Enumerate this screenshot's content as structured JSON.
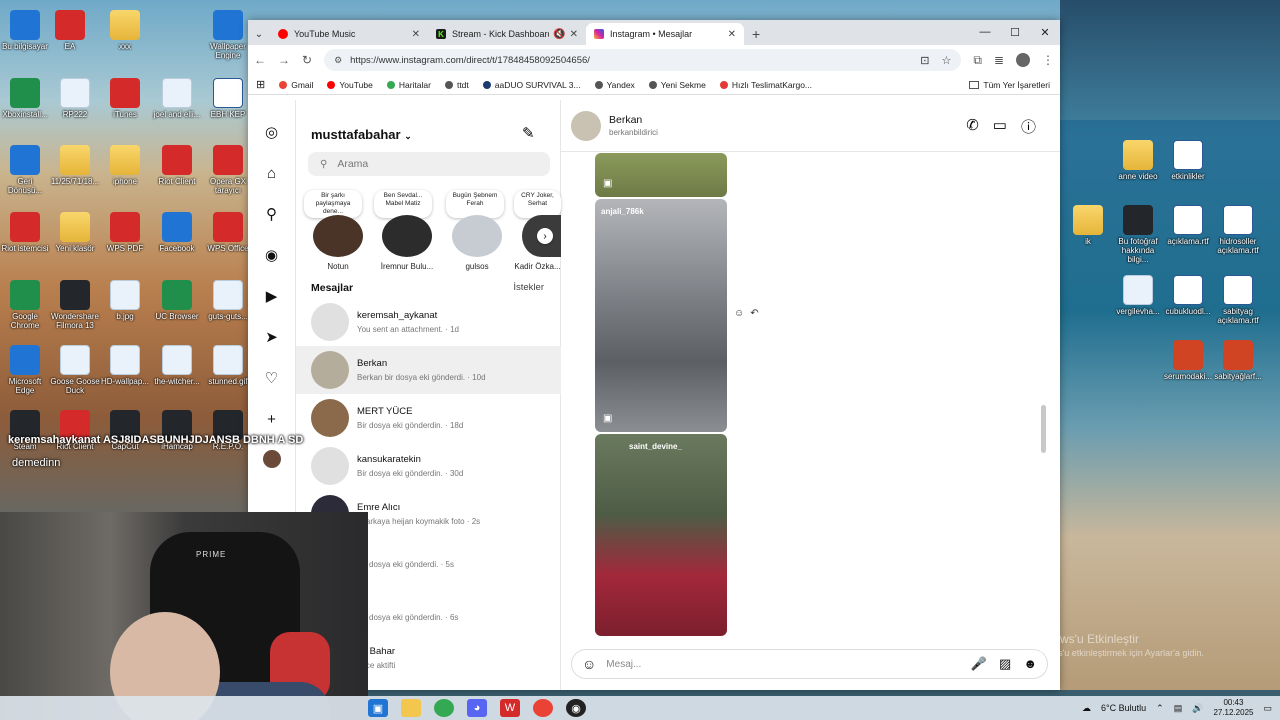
{
  "desktop": {
    "left_icons": [
      {
        "label": "Bu bilgisayar"
      },
      {
        "label": "EA"
      },
      {
        "label": "xxx"
      },
      {
        "label": "Wallpaper Engine"
      },
      {
        "label": "Xboxinstall..."
      },
      {
        "label": "RP222"
      },
      {
        "label": "iTunes"
      },
      {
        "label": "joel and elli..."
      },
      {
        "label": "EBH KEP"
      },
      {
        "label": "Geri Dönüşü..."
      },
      {
        "label": "11/25/71/18..."
      },
      {
        "label": "iphone"
      },
      {
        "label": "Riot Client"
      },
      {
        "label": "Opera GX tarayıcı"
      },
      {
        "label": "Riot istemcisi"
      },
      {
        "label": "Yeni klasör"
      },
      {
        "label": "WPS PDF"
      },
      {
        "label": "Facebook"
      },
      {
        "label": "WPS Office"
      },
      {
        "label": "Google Chrome"
      },
      {
        "label": "Wondershare Filmora 13"
      },
      {
        "label": "b.jpg"
      },
      {
        "label": "UC Browser"
      },
      {
        "label": "guts-guts..."
      },
      {
        "label": "Microsoft Edge"
      },
      {
        "label": "Goose Goose Duck"
      },
      {
        "label": "HD-wallpap..."
      },
      {
        "label": "the-witcher..."
      },
      {
        "label": "stunned.gif"
      },
      {
        "label": "Steam"
      },
      {
        "label": "Riot Client"
      },
      {
        "label": "CapCut"
      },
      {
        "label": "iHamcap"
      },
      {
        "label": "R.E.P.O."
      }
    ],
    "right_icons": [
      {
        "label": "anne video"
      },
      {
        "label": "etkinlikler"
      },
      {
        "label": "ik"
      },
      {
        "label": "Bu fotoğraf hakkında bilgi..."
      },
      {
        "label": "açıklama.rtf"
      },
      {
        "label": "hidrosoller açıklama.rtf"
      },
      {
        "label": "vergilevha..."
      },
      {
        "label": "cubukluodl..."
      },
      {
        "label": "sabityag açıklama.rtf"
      },
      {
        "label": "serumodaki..."
      },
      {
        "label": "sabityağlarf..."
      }
    ]
  },
  "browser": {
    "tabs": [
      {
        "title": "YouTube Music",
        "color": "#ff0000"
      },
      {
        "title": "Stream - Kick Dashboard",
        "color": "#53fc18"
      },
      {
        "title": "Instagram • Mesajlar",
        "color": "#d6249f"
      }
    ],
    "url": "https://www.instagram.com/direct/t/17848458092504656/",
    "bookmarks": [
      {
        "label": "Gmail",
        "color": "#ea4335"
      },
      {
        "label": "YouTube",
        "color": "#ff0000"
      },
      {
        "label": "Haritalar",
        "color": "#34a853"
      },
      {
        "label": "ttdt",
        "color": "#555555"
      },
      {
        "label": "aaDUO SURVIVAL 3...",
        "color": "#1e3c72"
      },
      {
        "label": "Yandex",
        "color": "#555555"
      },
      {
        "label": "Yeni Sekme",
        "color": "#555555"
      },
      {
        "label": "Hızlı TeslimatKargo...",
        "color": "#e53935"
      }
    ],
    "all_bookmarks": "Tüm Yer İşaretleri"
  },
  "instagram": {
    "username": "musttafabahar",
    "search_placeholder": "Arama",
    "notes": [
      {
        "note": "Bir şarkı paylaşmaya dene...",
        "label": "Notun"
      },
      {
        "note": "Ben Sevdal... Mabel Matiz",
        "label": "İremnur Bulu..."
      },
      {
        "note": "Bugün Şebnem Ferah",
        "label": "gulsos"
      },
      {
        "note": "CRY Joker, Serhat",
        "label": "Kadir Özka..."
      }
    ],
    "messages_header": "Mesajlar",
    "requests": "İstekler",
    "conversations": [
      {
        "name": "keremsah_aykanat",
        "preview": "You sent an attachment. · 1d",
        "color": "#e0e0e0"
      },
      {
        "name": "Berkan",
        "preview": "Berkan bir dosya eki gönderdi. · 10d",
        "color": "#b5ad9c"
      },
      {
        "name": "MERT YÜCE",
        "preview": "Bir dosya eki gönderdin. · 18d",
        "color": "#8a6a4a"
      },
      {
        "name": "kansukaratekin",
        "preview": "Bir dosya eki gönderdin. · 30d",
        "color": "#e0e0e0"
      },
      {
        "name": "Emre Alıcı",
        "preview": "e: arkaya heijan koymakik foto · 2s",
        "color": "#2b2b3a"
      },
      {
        "name": "",
        "preview": "Bir dosya eki gönderdi. · 5s",
        "color": "#555555"
      },
      {
        "name": "-D",
        "preview": "Bir dosya eki gönderdin. · 6s",
        "color": "#555555"
      },
      {
        "name": "mi Bahar",
        "preview": "önce aktifti",
        "color": "#555555"
      }
    ],
    "chat": {
      "name": "Berkan",
      "handle": "berkanbildirici",
      "media": [
        {
          "caption": ""
        },
        {
          "caption": "anjali_786k"
        },
        {
          "caption": "saint_devine_"
        }
      ],
      "composer_placeholder": "Mesaj..."
    }
  },
  "webcam": {
    "overlay_line1": "keremsahaykanat  ASJ8IDASBUNHJDJANSB DBNH A SD",
    "overlay_line2": "demedinn",
    "chair_brand": "PRIME"
  },
  "watermark": {
    "line1": "Windows'u Etkinleştir",
    "line2": "Windows'u etkinleştirmek için Ayarlar'a gidin."
  },
  "taskbar": {
    "weather": "6°C  Bulutlu",
    "time": "00:43",
    "date": "27.12.2025"
  }
}
